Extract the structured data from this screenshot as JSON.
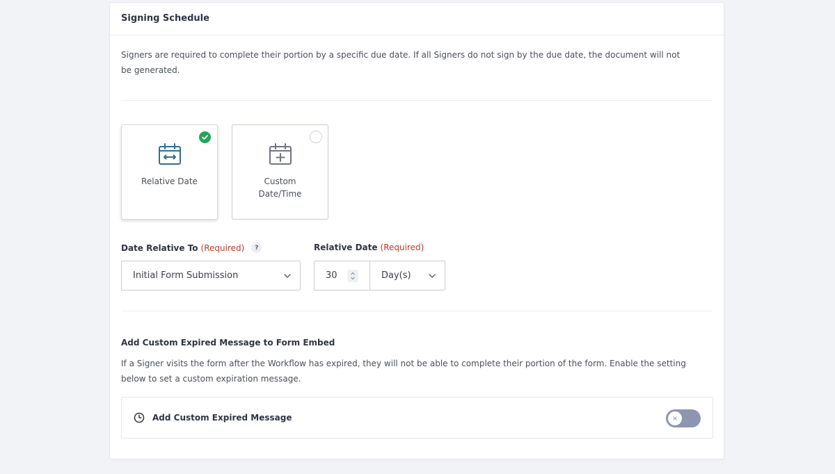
{
  "panel": {
    "title": "Signing Schedule",
    "intro": "Signers are required to complete their portion by a specific due date. If all Signers do not sign by the due date, the document will not be generated."
  },
  "date_type_options": [
    {
      "label": "Relative Date",
      "icon": "calendar-arrows-icon",
      "selected": true
    },
    {
      "label": "Custom Date/Time",
      "icon": "calendar-plus-icon",
      "selected": false
    }
  ],
  "date_relative_to": {
    "label": "Date Relative To",
    "required_text": "(Required)",
    "help_glyph": "?",
    "value": "Initial Form Submission"
  },
  "relative_date": {
    "label": "Relative Date",
    "required_text": "(Required)",
    "amount": "30",
    "unit": "Day(s)"
  },
  "expired_message": {
    "title": "Add Custom Expired Message to Form Embed",
    "description": "If a Signer visits the form after the Workflow has expired, they will not be able to complete their portion of the form. Enable the setting below to set a custom expiration message.",
    "toggle_label": "Add Custom Expired Message",
    "toggle_on": false,
    "toggle_knob_glyph": "×"
  },
  "colors": {
    "accent_green": "#23a559",
    "icon_blue": "#2f6f8f",
    "icon_grey": "#6f7480",
    "required_red": "#c0392b",
    "toggle_off": "#8e95b0"
  }
}
